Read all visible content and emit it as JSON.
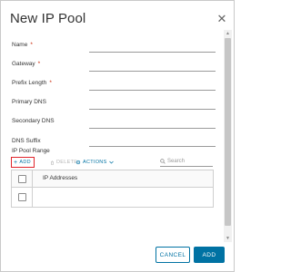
{
  "dialog": {
    "title": "New IP Pool",
    "close_icon": "close-icon"
  },
  "form": {
    "fields": [
      {
        "label": "Name",
        "required": true
      },
      {
        "label": "Gateway",
        "required": true
      },
      {
        "label": "Prefix Length",
        "required": true
      },
      {
        "label": "Primary DNS",
        "required": false
      },
      {
        "label": "Secondary DNS",
        "required": false
      },
      {
        "label": "DNS Suffix",
        "required": false
      }
    ],
    "required_mark": "*"
  },
  "ip_pool_range": {
    "label": "IP Pool Range",
    "toolbar": {
      "add_icon": "plus-icon",
      "add_label": "ADD",
      "delete_icon": "delete-icon",
      "delete_label": "DELETE",
      "actions_icon": "gear-icon",
      "actions_label": "ACTIONS",
      "actions_chevron": "chevron-down-icon"
    },
    "search": {
      "icon": "search-icon",
      "placeholder": "Search"
    },
    "table": {
      "columns": [
        "IP Addresses"
      ],
      "rows": [
        [
          ""
        ]
      ]
    }
  },
  "footer": {
    "cancel_label": "CANCEL",
    "add_label": "ADD"
  },
  "colors": {
    "accent": "#0072a3",
    "required": "#c92100",
    "highlight_border": "#e0252b"
  }
}
